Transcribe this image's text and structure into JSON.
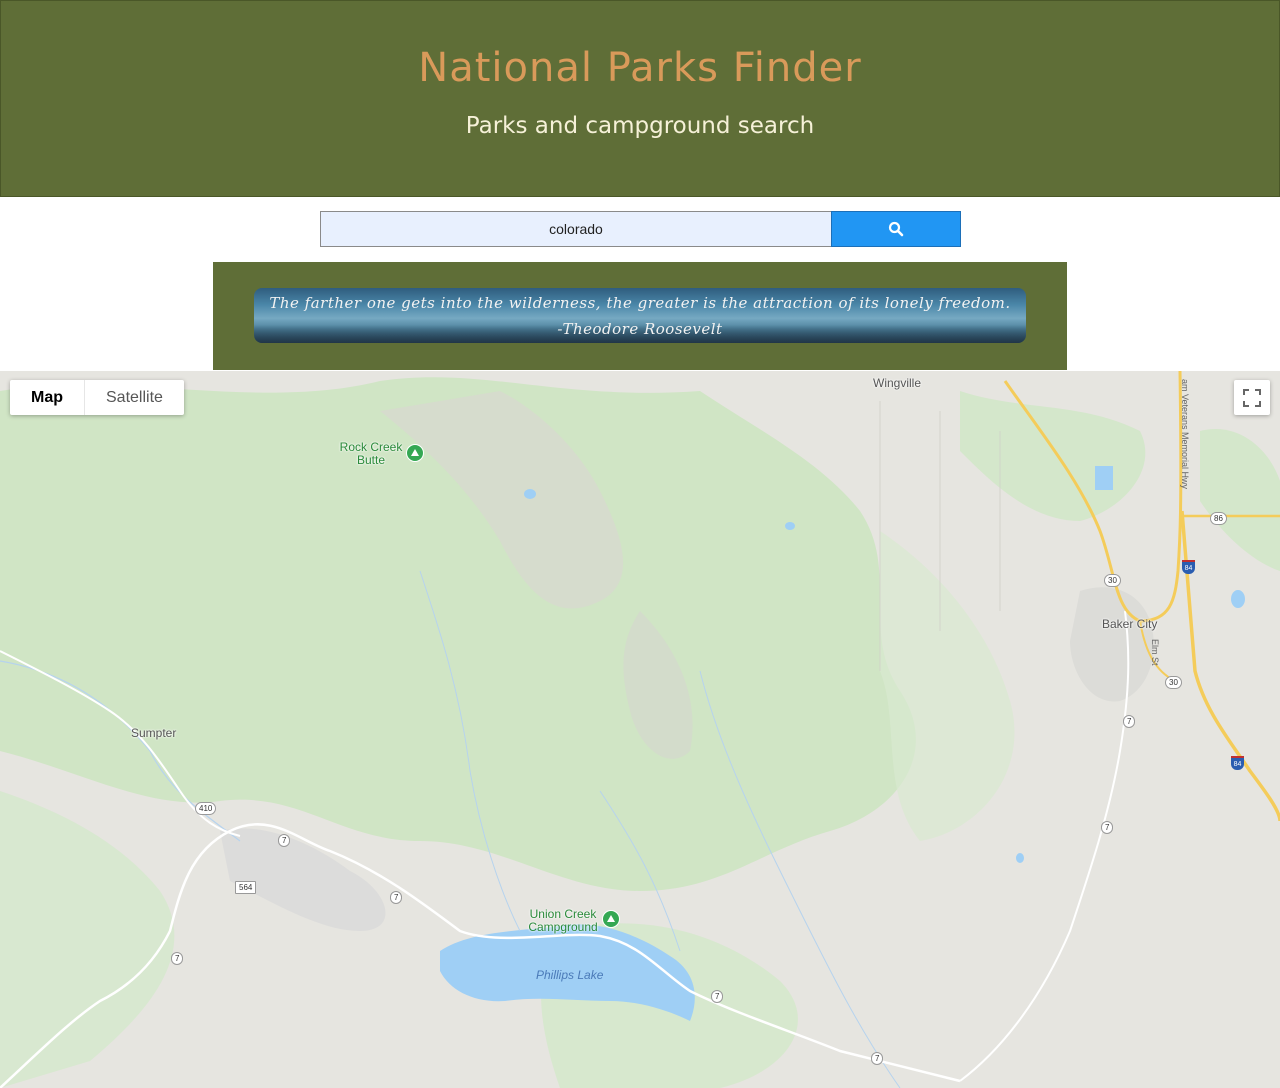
{
  "header": {
    "title": "National Parks Finder",
    "subtitle": "Parks and campground search",
    "bg_color": "#5f6e37",
    "title_color": "#d99a5a",
    "subtitle_color": "#f6f1d8"
  },
  "search": {
    "value": "colorado",
    "button_icon": "search-icon",
    "button_color": "#2196f3"
  },
  "quote": {
    "text": "The farther one gets into the wilderness, the greater is the attraction of its lonely freedom. -Theodore Roosevelt"
  },
  "map": {
    "type_buttons": [
      "Map",
      "Satellite"
    ],
    "active_type": "Map",
    "fullscreen_icon": "fullscreen-icon",
    "places": {
      "wingville": "Wingville",
      "rock_creek_butte": "Rock Creek Butte",
      "baker_city": "Baker City",
      "sumpter": "Sumpter",
      "union_creek_campground": "Union Creek Campground",
      "phillips_lake": "Phillips Lake",
      "elm_st": "Elm St",
      "veterans_hwy": "am Veterans Memorial Hwy"
    },
    "route_shields": {
      "r86": "86",
      "r84a": "84",
      "r84b": "84",
      "r30a": "30",
      "r30b": "30",
      "r7a": "7",
      "r7b": "7",
      "r7c": "7",
      "r7d": "7",
      "r7e": "7",
      "r7f": "7",
      "r7g": "7",
      "r410": "410",
      "r564": "564"
    }
  }
}
